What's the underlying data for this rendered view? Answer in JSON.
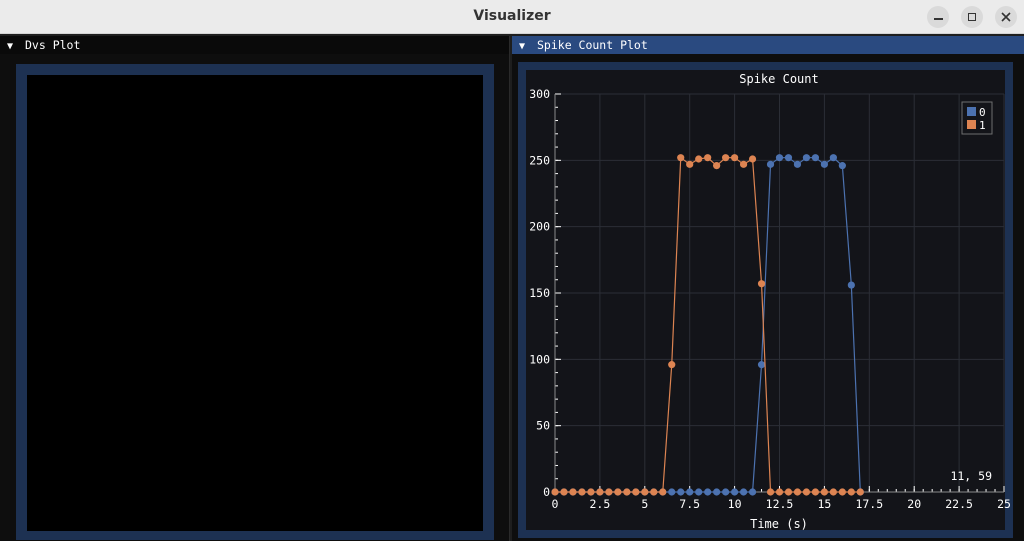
{
  "window": {
    "title": "Visualizer",
    "controls": [
      "minimize-icon",
      "maximize-icon",
      "close-icon"
    ]
  },
  "panels": {
    "dvs": {
      "label": "Dvs Plot",
      "arrow": "▼"
    },
    "spike": {
      "label": "Spike Count Plot",
      "arrow": "▼"
    }
  },
  "colors": {
    "series0": "#4c72b0",
    "series1": "#dd8452",
    "header_active": "#2a4a80",
    "header_inactive": "#0a0a0a",
    "frame": "#1d3152",
    "plot_bg": "#131419"
  },
  "cursor_readout": "11, 59",
  "chart_data": {
    "type": "line",
    "title": "Spike Count",
    "xlabel": "Time (s)",
    "ylabel": "",
    "xlim": [
      0,
      25
    ],
    "ylim": [
      0,
      300
    ],
    "x_ticks": [
      "0",
      "2.5",
      "5",
      "7.5",
      "10",
      "12.5",
      "15",
      "17.5",
      "20",
      "22.5",
      "25"
    ],
    "y_ticks": [
      "0",
      "50",
      "100",
      "150",
      "200",
      "250",
      "300"
    ],
    "grid": true,
    "legend_position": "top-right",
    "markers": true,
    "series": [
      {
        "name": "0",
        "color": "#4c72b0",
        "x": [
          0,
          0.5,
          1,
          1.5,
          2,
          2.5,
          3,
          3.5,
          4,
          4.5,
          5,
          5.5,
          6,
          6.5,
          7,
          7.5,
          8,
          8.5,
          9,
          9.5,
          10,
          10.5,
          11,
          11.5,
          12,
          12.5,
          13,
          13.5,
          14,
          14.5,
          15,
          15.5,
          16,
          16.5,
          17
        ],
        "y": [
          0,
          0,
          0,
          0,
          0,
          0,
          0,
          0,
          0,
          0,
          0,
          0,
          0,
          0,
          0,
          0,
          0,
          0,
          0,
          0,
          0,
          0,
          0,
          96,
          247,
          252,
          252,
          247,
          252,
          252,
          247,
          252,
          246,
          156,
          0
        ]
      },
      {
        "name": "1",
        "color": "#dd8452",
        "x": [
          0,
          0.5,
          1,
          1.5,
          2,
          2.5,
          3,
          3.5,
          4,
          4.5,
          5,
          5.5,
          6,
          6.5,
          7,
          7.5,
          8,
          8.5,
          9,
          9.5,
          10,
          10.5,
          11,
          11.5,
          12,
          12.5,
          13,
          13.5,
          14,
          14.5,
          15,
          15.5,
          16,
          16.5,
          17
        ],
        "y": [
          0,
          0,
          0,
          0,
          0,
          0,
          0,
          0,
          0,
          0,
          0,
          0,
          0,
          96,
          252,
          247,
          251,
          252,
          246,
          252,
          252,
          247,
          251,
          157,
          0,
          0,
          0,
          0,
          0,
          0,
          0,
          0,
          0,
          0,
          0
        ]
      }
    ]
  }
}
